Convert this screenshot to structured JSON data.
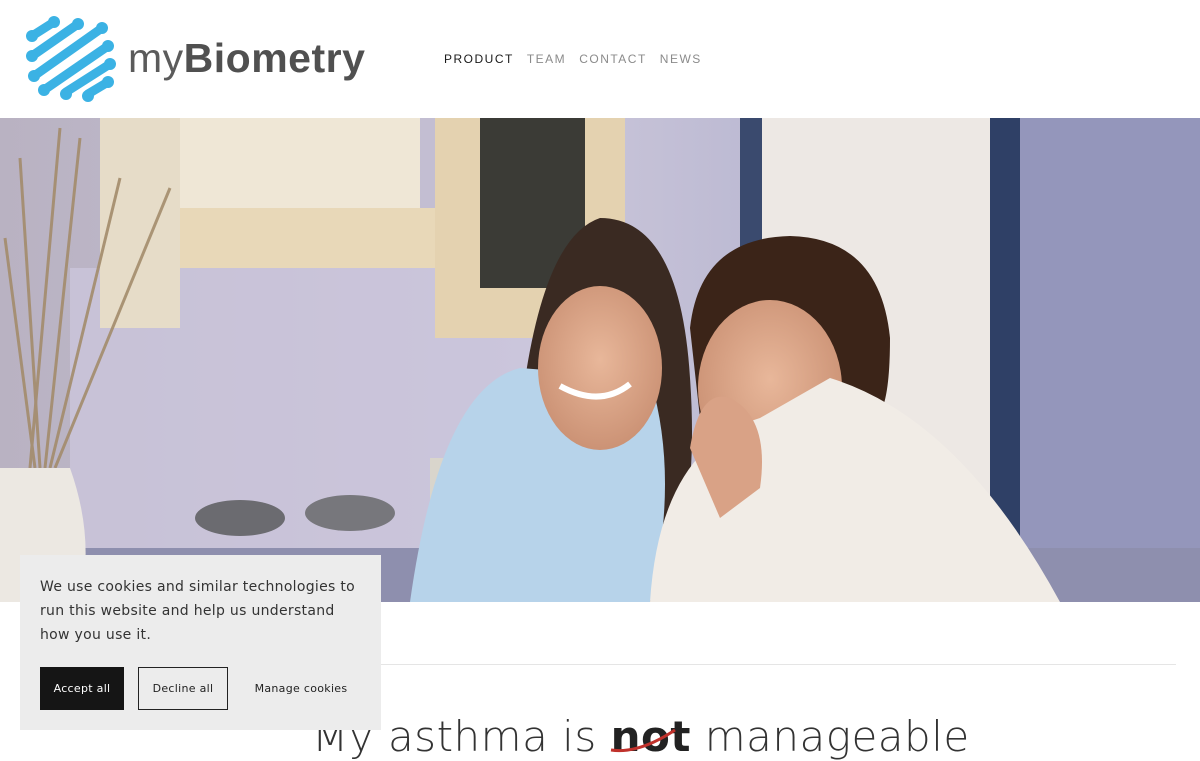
{
  "brand": {
    "prefix": "my",
    "name": "Biometry",
    "accent_color": "#3bb2e4"
  },
  "nav": {
    "items": [
      {
        "label": "PRODUCT",
        "active": true
      },
      {
        "label": "TEAM",
        "active": false
      },
      {
        "label": "CONTACT",
        "active": false
      },
      {
        "label": "NEWS",
        "active": false
      }
    ]
  },
  "hero": {
    "image_icon": "photo-icon"
  },
  "headline": {
    "before": "My asthma is ",
    "negated": "not",
    "after": " manageable"
  },
  "cookie_banner": {
    "message": "We use cookies and similar technologies to run this website and help us understand how you use it.",
    "accept_label": "Accept all",
    "decline_label": "Decline all",
    "manage_label": "Manage cookies"
  }
}
